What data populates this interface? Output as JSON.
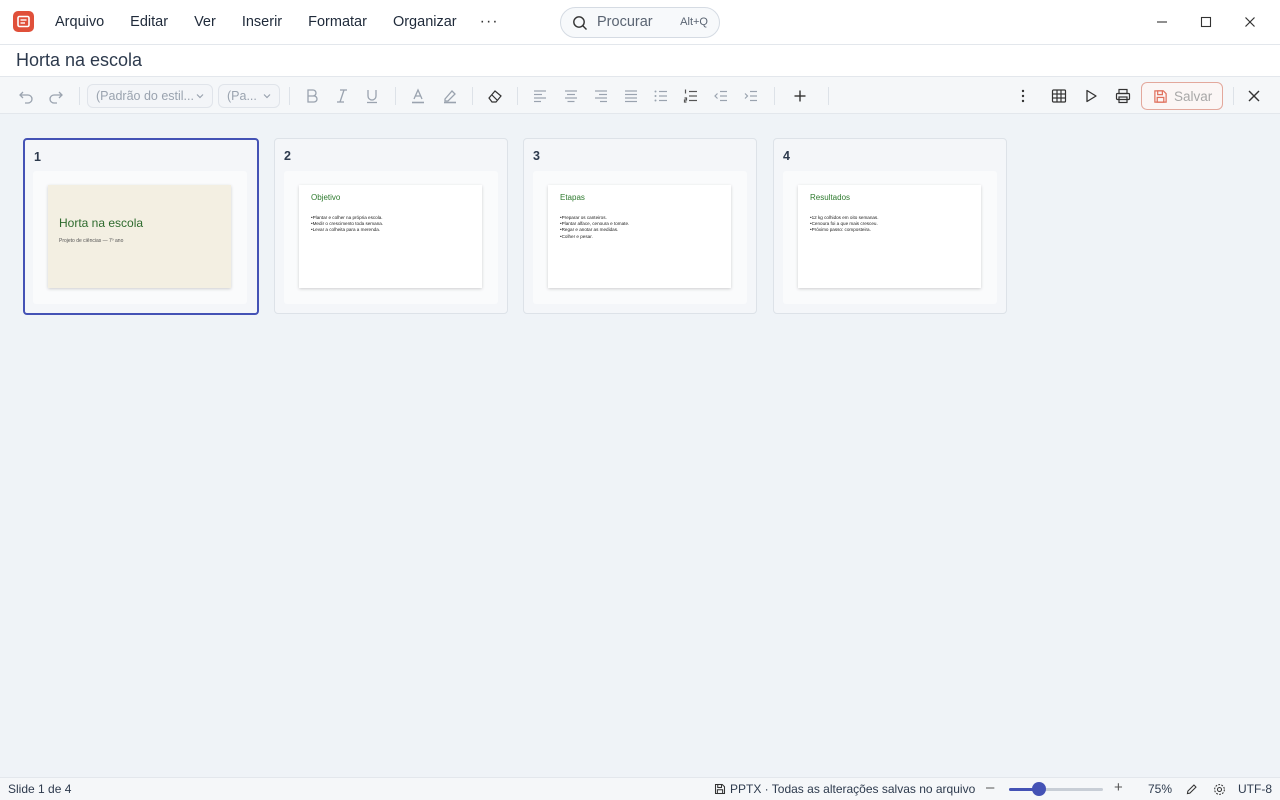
{
  "app": {
    "menu": [
      "Arquivo",
      "Editar",
      "Ver",
      "Inserir",
      "Formatar",
      "Organizar"
    ],
    "more": "···",
    "search_placeholder": "Procurar",
    "search_shortcut": "Alt+Q",
    "accent": "#4452b5",
    "logo_color": "#e0503a"
  },
  "document": {
    "title": "Horta na escola"
  },
  "toolbar": {
    "style_select": "(Padrão do estil...",
    "size_select": "(Pa...",
    "save_label": "Salvar"
  },
  "slides": [
    {
      "number": "1",
      "kind": "cover",
      "title": "Horta na escola",
      "subtitle": "Projeto de ciências — 7º ano"
    },
    {
      "number": "2",
      "title": "Objetivo",
      "bullets": [
        "•Plantar e colher na própria escola.",
        "•Medir o crescimento toda semana.",
        "•Levar a colheita para a merenda."
      ]
    },
    {
      "number": "3",
      "title": "Etapas",
      "bullets": [
        "•Preparar os canteiros.",
        "•Plantar alface, cenoura e tomate.",
        "•Regar e anotar as medidas.",
        "•Colher e pesar."
      ]
    },
    {
      "number": "4",
      "title": "Resultados",
      "bullets": [
        "•12 kg colhidos em oito semanas.",
        "•Cenoura foi a que mais cresceu.",
        "•Próximo passo: composteira."
      ]
    }
  ],
  "status": {
    "slide_info": "Slide 1 de 4",
    "file_info": "PPTX · Todas as alterações salvas no arquivo",
    "zoom_minus": "–",
    "zoom_plus": "+",
    "zoom": "75%",
    "zoom_fraction": 0.32,
    "encoding": "UTF-8"
  }
}
